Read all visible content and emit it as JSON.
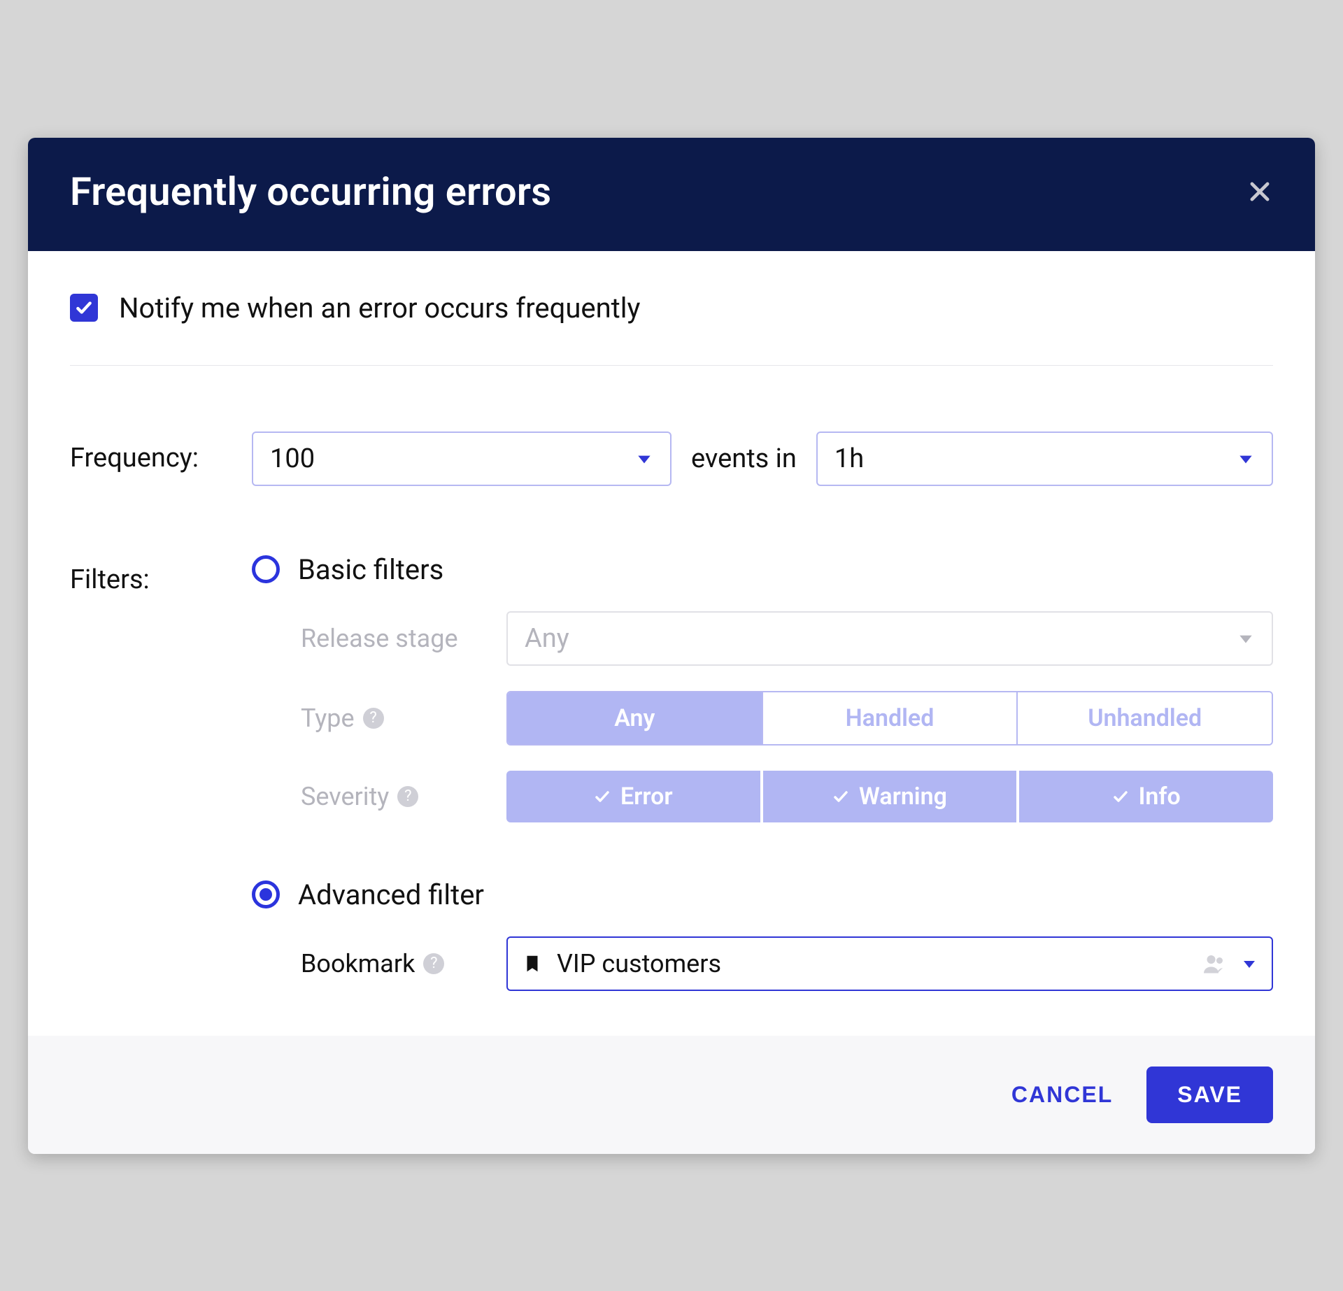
{
  "colors": {
    "header_bg": "#0c1a4a",
    "accent": "#3036d6",
    "accent_light": "#b1b6f3",
    "muted_text": "#b4b4bc"
  },
  "header": {
    "title": "Frequently occurring errors"
  },
  "notify": {
    "checked": true,
    "label": "Notify me when an error occurs frequently"
  },
  "frequency": {
    "label": "Frequency:",
    "count_value": "100",
    "events_in_text": "events in",
    "window_value": "1h"
  },
  "filters": {
    "label": "Filters:",
    "basic": {
      "selected": false,
      "label": "Basic filters",
      "release_stage": {
        "label": "Release stage",
        "value": "Any"
      },
      "type": {
        "label": "Type",
        "help": "?",
        "options": [
          "Any",
          "Handled",
          "Unhandled"
        ],
        "selected_index": 0
      },
      "severity": {
        "label": "Severity",
        "help": "?",
        "options": [
          "Error",
          "Warning",
          "Info"
        ],
        "selected": [
          true,
          true,
          true
        ]
      }
    },
    "advanced": {
      "selected": true,
      "label": "Advanced filter",
      "bookmark": {
        "label": "Bookmark",
        "help": "?",
        "value": "VIP customers"
      }
    }
  },
  "footer": {
    "cancel": "CANCEL",
    "save": "SAVE"
  }
}
